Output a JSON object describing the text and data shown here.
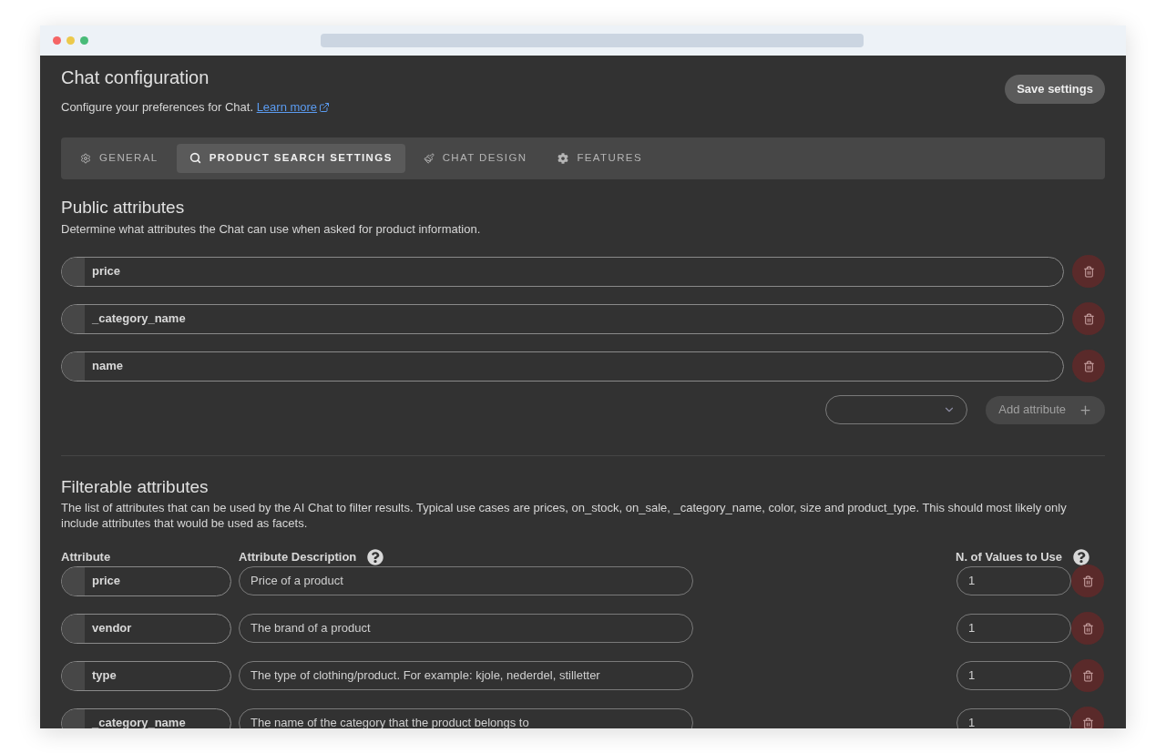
{
  "header": {
    "title": "Chat configuration",
    "subtitle": "Configure your preferences for Chat.",
    "learn_more_link": "Learn more",
    "save_button": "Save settings"
  },
  "tabs": [
    {
      "label": "GENERAL",
      "selected": false
    },
    {
      "label": "PRODUCT SEARCH SETTINGS",
      "selected": true
    },
    {
      "label": "CHAT DESIGN",
      "selected": false
    },
    {
      "label": "FEATURES",
      "selected": false
    }
  ],
  "public_attributes": {
    "title": "Public attributes",
    "description": "Determine what attributes the Chat can use when asked for product information.",
    "items": [
      {
        "value": "price"
      },
      {
        "value": "_category_name"
      },
      {
        "value": "name"
      }
    ],
    "add_button": "Add attribute"
  },
  "filterable_attributes": {
    "title": "Filterable attributes",
    "description": "The list of attributes that can be used by the AI Chat to filter results. Typical use cases are prices, on_stock, on_sale, _category_name, color, size and product_type. This should most likely only include attributes that would be used as facets.",
    "columns": [
      {
        "label": "Attribute",
        "help": false
      },
      {
        "label": "Attribute Description",
        "help": true
      },
      {
        "label": "N. of Values to Use",
        "help": true
      }
    ],
    "rows": [
      {
        "attribute": "price",
        "description": "Price of a product",
        "values_count": "1"
      },
      {
        "attribute": "vendor",
        "description": "The brand of a product",
        "values_count": "1"
      },
      {
        "attribute": "type",
        "description": "The type of clothing/product. For example: kjole, nederdel, stilletter",
        "values_count": "1"
      },
      {
        "attribute": "_category_name",
        "description": "The name of the category that the product belongs to",
        "values_count": "1"
      }
    ]
  }
}
